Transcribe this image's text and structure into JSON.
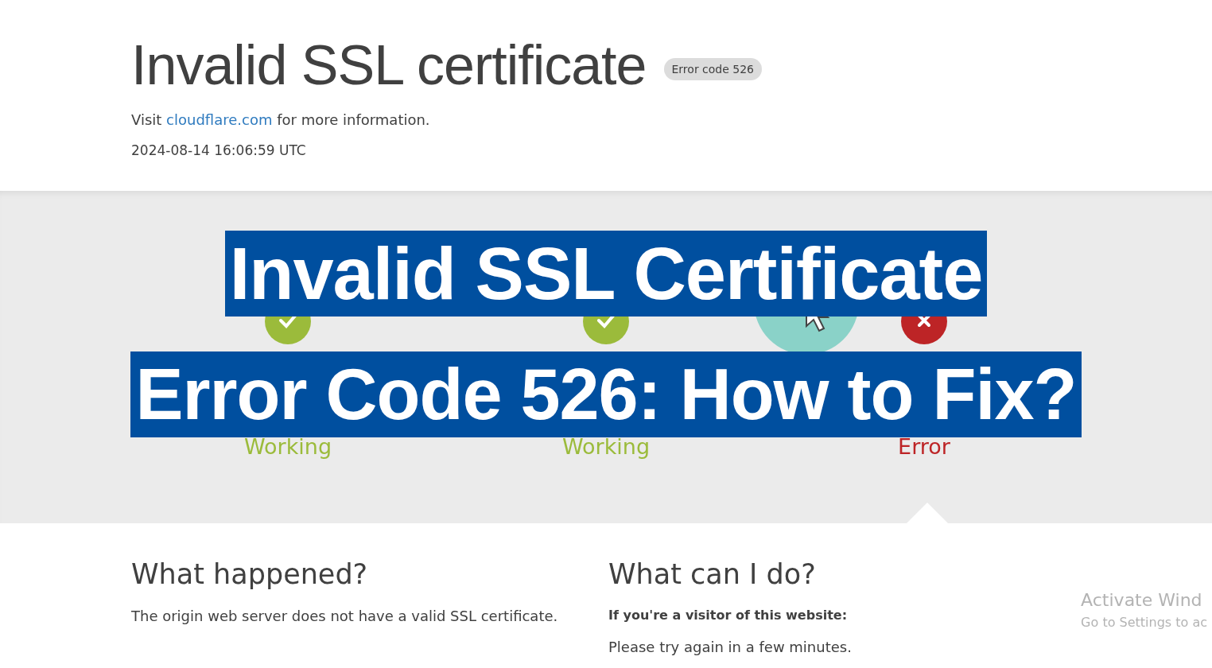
{
  "header": {
    "title": "Invalid SSL certificate",
    "badge": "Error code 526",
    "info_before": "Visit ",
    "link": "cloudflare.com",
    "info_after": " for more information.",
    "timestamp": "2024-08-14 16:06:59 UTC"
  },
  "diagram": {
    "nodes": [
      {
        "kind": "working",
        "label": "Working",
        "color": "#9bbb3b"
      },
      {
        "kind": "working",
        "label": "Working",
        "color": "#9bbb3b"
      },
      {
        "kind": "error",
        "label": "Error",
        "color": "#bd2426"
      }
    ]
  },
  "banner": {
    "lines": [
      "Invalid SSL Certificate",
      "Error Code 526: How to Fix?"
    ]
  },
  "sections": [
    {
      "heading": "What happened?",
      "paragraphs": [
        {
          "kind": "body",
          "text": "The origin web server does not have a valid SSL certificate."
        }
      ]
    },
    {
      "heading": "What can I do?",
      "paragraphs": [
        {
          "kind": "subheading",
          "text": "If you're a visitor of this website:"
        },
        {
          "kind": "body",
          "text": "Please try again in a few minutes."
        }
      ]
    }
  ],
  "os_notice": {
    "title": "Activate Wind",
    "hint": "Go to Settings to ac"
  }
}
